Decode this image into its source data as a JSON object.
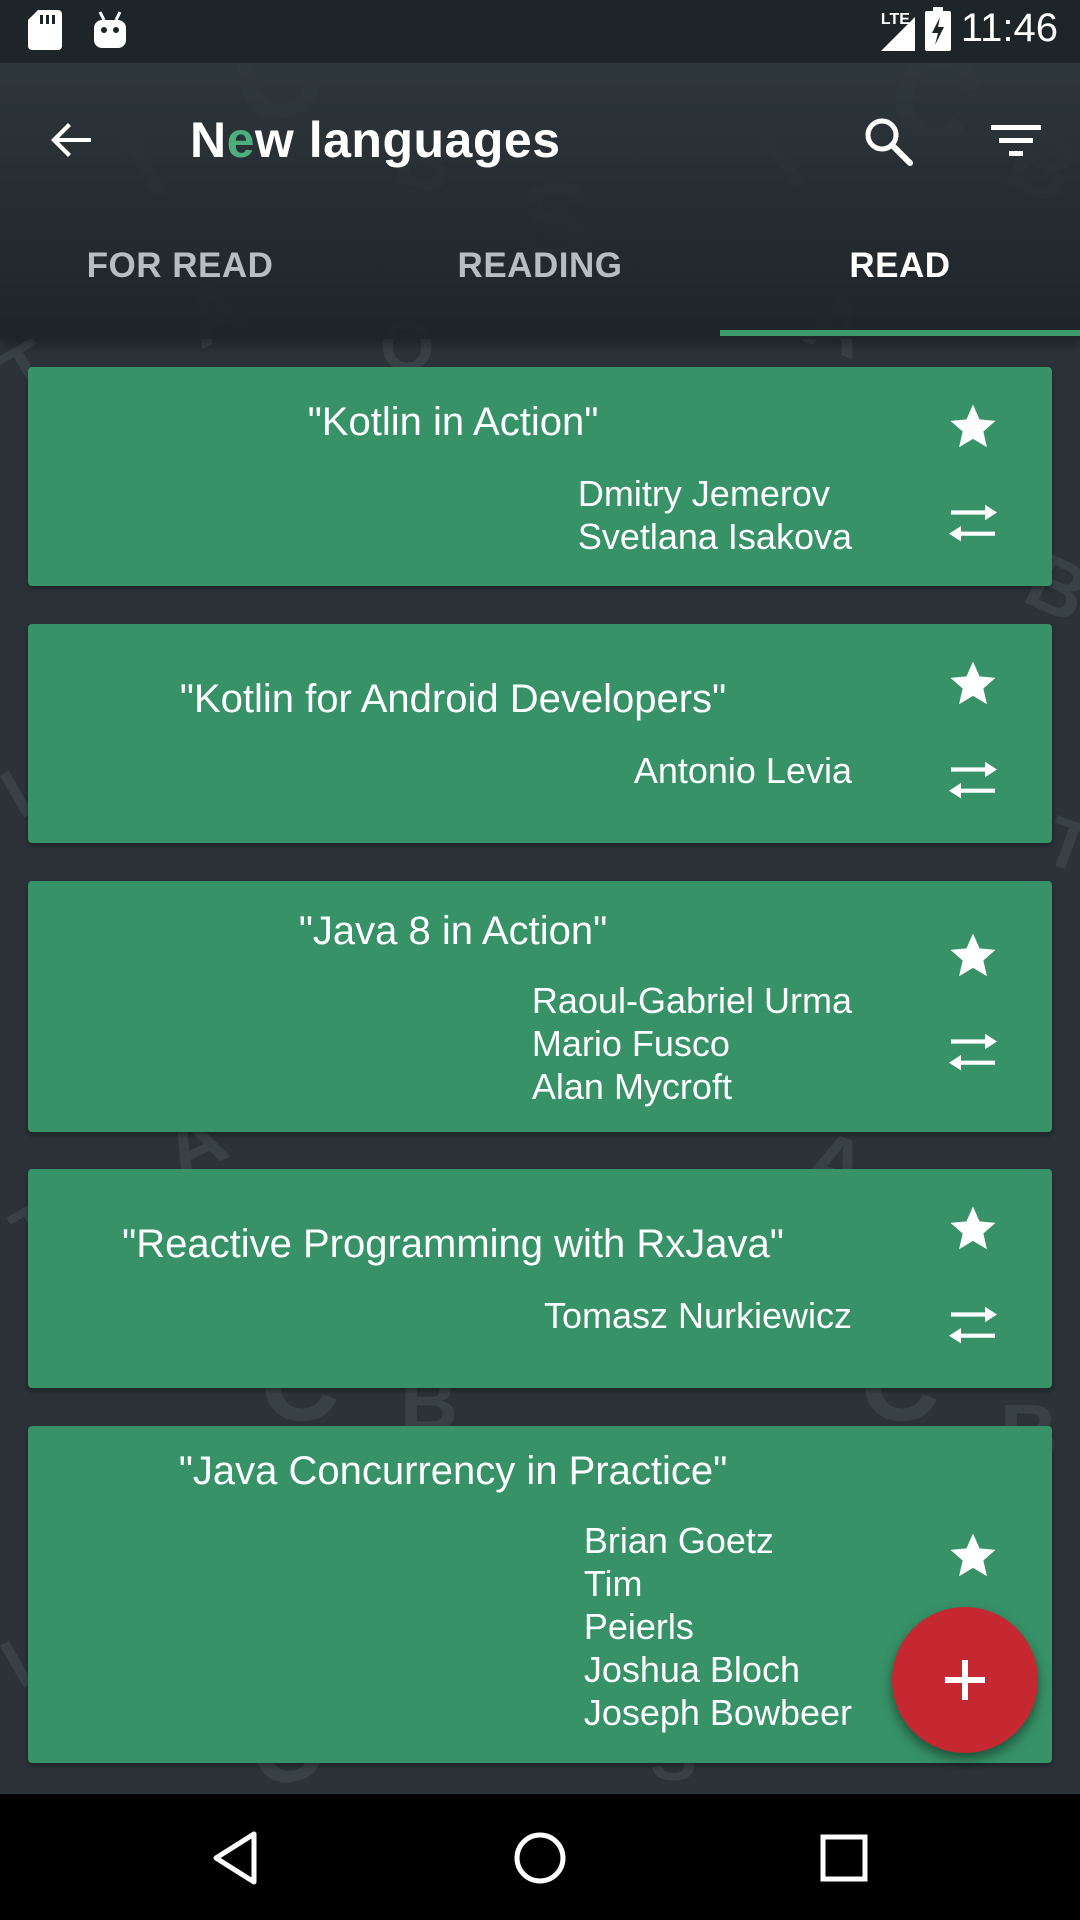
{
  "status_bar": {
    "time": "11:46",
    "network": "LTE",
    "left_icons": [
      "sd-card-icon",
      "android-debug-icon"
    ],
    "right_icons": [
      "signal-icon",
      "battery-charging-icon"
    ]
  },
  "toolbar": {
    "title_first": "N",
    "title_accent": "e",
    "title_rest": "w languages",
    "back_icon": "arrow-back-icon",
    "search_icon": "search-icon",
    "filter_icon": "filter-icon"
  },
  "tabs": [
    {
      "label": "FOR READ",
      "active": false
    },
    {
      "label": "READING",
      "active": false
    },
    {
      "label": "READ",
      "active": true
    }
  ],
  "books": [
    {
      "title": "\"Kotlin in Action\"",
      "authors": [
        "Dmitry Jemerov",
        "Svetlana Isakova"
      ]
    },
    {
      "title": "\"Kotlin for Android Developers\"",
      "authors": [
        "Antonio Levia"
      ]
    },
    {
      "title": "\"Java 8 in Action\"",
      "authors": [
        "Raoul-Gabriel Urma",
        "Mario Fusco",
        "Alan Mycroft"
      ]
    },
    {
      "title": "\"Reactive Programming with RxJava\"",
      "authors": [
        "Tomasz Nurkiewicz"
      ]
    },
    {
      "title": "\"Java Concurrency in Practice\"",
      "authors": [
        "Brian Goetz",
        "Tim",
        "Peierls",
        "Joshua Bloch",
        "Joseph Bowbeer"
      ]
    }
  ],
  "fab": {
    "icon": "plus-icon"
  },
  "nav_bar": {
    "icons": [
      "back-triangle-icon",
      "home-circle-icon",
      "recents-square-icon"
    ]
  },
  "colors": {
    "card": "#379267",
    "accent": "#3d9b6b",
    "fab": "#c62832",
    "toolbar": "#263035"
  }
}
